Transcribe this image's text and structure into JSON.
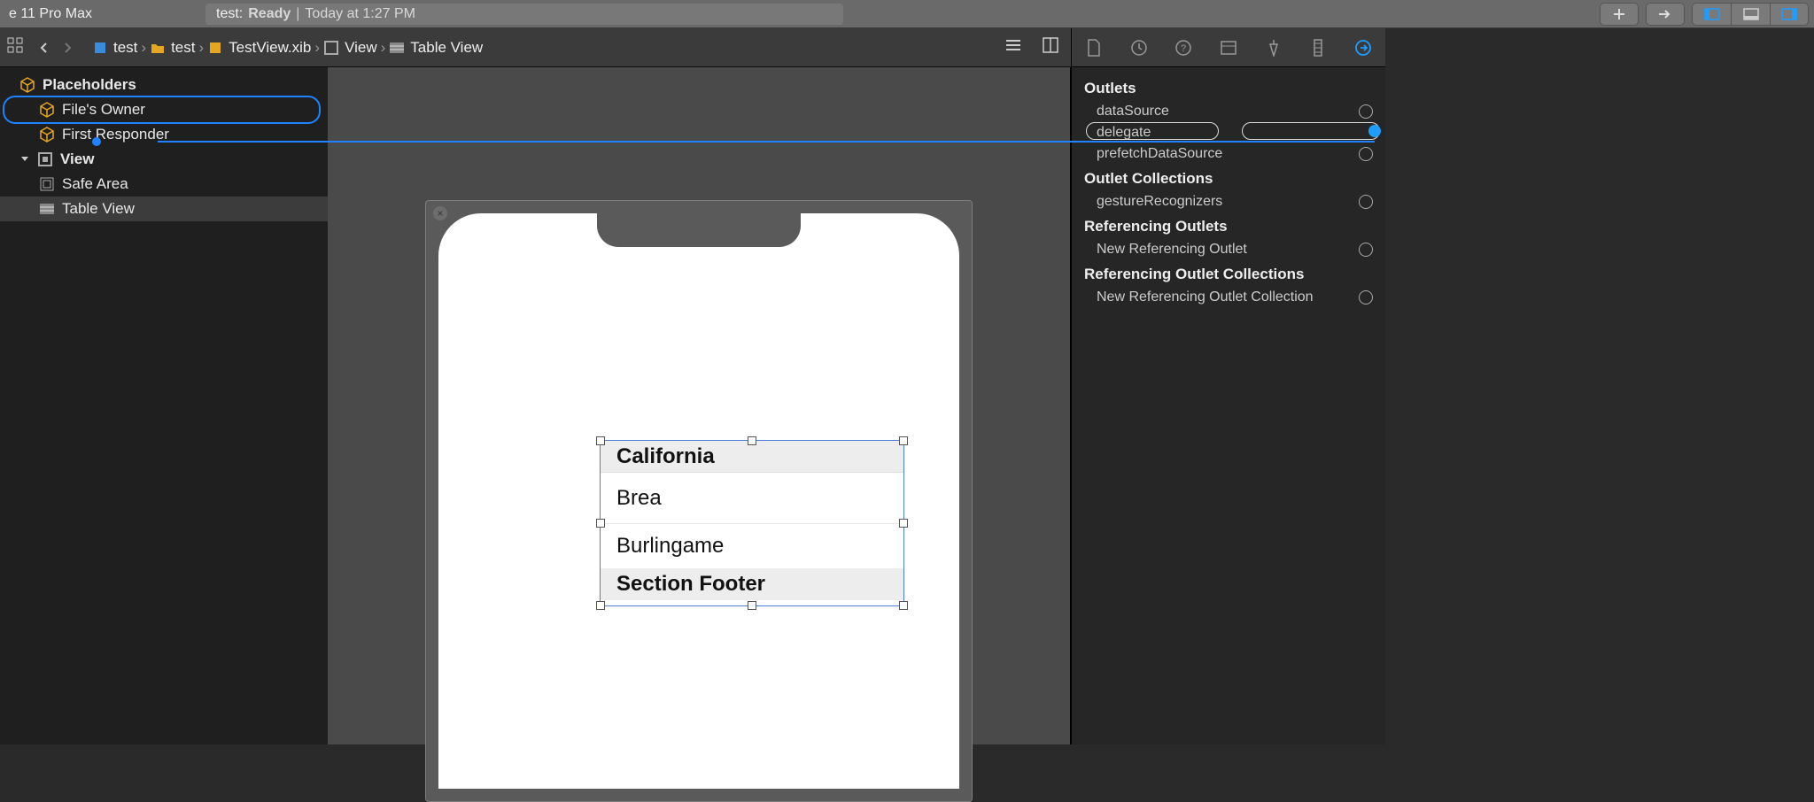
{
  "toolbar": {
    "device": "e 11 Pro Max",
    "status_prefix": "test:",
    "status_state": "Ready",
    "status_sep": "|",
    "status_time": "Today at 1:27 PM"
  },
  "breadcrumb": {
    "items": [
      {
        "icon": "project",
        "label": "test"
      },
      {
        "icon": "folder",
        "label": "test"
      },
      {
        "icon": "xib",
        "label": "TestView.xib"
      },
      {
        "icon": "view",
        "label": "View"
      },
      {
        "icon": "table",
        "label": "Table View"
      }
    ]
  },
  "outline": {
    "placeholders_label": "Placeholders",
    "files_owner": "File's Owner",
    "first_responder": "First Responder",
    "view_label": "View",
    "safe_area": "Safe Area",
    "table_view": "Table View"
  },
  "canvas": {
    "table": {
      "header": "California",
      "cells": [
        "Brea",
        "Burlingame"
      ],
      "footer": "Section Footer"
    }
  },
  "inspector": {
    "sections": {
      "outlets": {
        "title": "Outlets",
        "items": [
          "dataSource",
          "delegate",
          "prefetchDataSource"
        ]
      },
      "outlet_collections": {
        "title": "Outlet Collections",
        "items": [
          "gestureRecognizers"
        ]
      },
      "referencing_outlets": {
        "title": "Referencing Outlets",
        "items": [
          "New Referencing Outlet"
        ]
      },
      "referencing_outlet_collections": {
        "title": "Referencing Outlet Collections",
        "items": [
          "New Referencing Outlet Collection"
        ]
      }
    }
  }
}
